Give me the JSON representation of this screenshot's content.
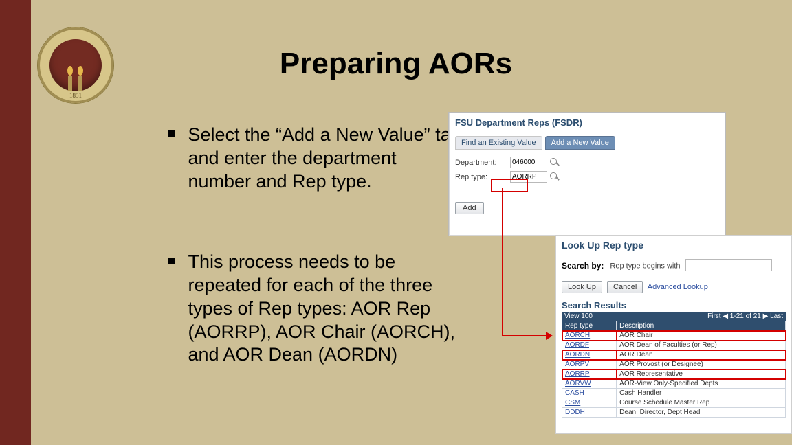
{
  "seal": {
    "year": "1851"
  },
  "title": "Preparing AORs",
  "bullets": [
    "Select the “Add a New Value” tab and enter the department number and Rep type.",
    "This process needs to be repeated for each of the three types of Rep types: AOR Rep (AORRP), AOR Chair (AORCH), and AOR Dean (AORDN)"
  ],
  "shot1": {
    "header": "FSU Department Reps (FSDR)",
    "tab_find": "Find an Existing Value",
    "tab_add": "Add a New Value",
    "dept_label": "Department:",
    "dept_value": "046000",
    "rep_label": "Rep type:",
    "rep_value": "AORRP",
    "add_btn": "Add"
  },
  "shot2": {
    "header": "Look Up Rep type",
    "search_by": "Search by:",
    "search_field": "Rep type",
    "begins": "begins with",
    "lookup": "Look Up",
    "cancel": "Cancel",
    "advanced": "Advanced Lookup",
    "results_hdr": "Search Results",
    "pager_left": "View 100",
    "pager_right": "First ◀ 1-21 of 21 ▶ Last",
    "col_code": "Rep type",
    "col_desc": "Description",
    "rows": [
      {
        "code": "AORCH",
        "desc": "AOR Chair",
        "hl": true
      },
      {
        "code": "AORDF",
        "desc": "AOR Dean of Faculties (or Rep)",
        "hl": false
      },
      {
        "code": "AORDN",
        "desc": "AOR Dean",
        "hl": true
      },
      {
        "code": "AORPV",
        "desc": "AOR Provost (or Designee)",
        "hl": false
      },
      {
        "code": "AORRP",
        "desc": "AOR Representative",
        "hl": true
      },
      {
        "code": "AORVW",
        "desc": "AOR-View Only-Specified Depts",
        "hl": false
      },
      {
        "code": "CASH",
        "desc": "Cash Handler",
        "hl": false
      },
      {
        "code": "CSM",
        "desc": "Course Schedule Master Rep",
        "hl": false
      },
      {
        "code": "DDDH",
        "desc": "Dean, Director, Dept Head",
        "hl": false
      }
    ]
  }
}
